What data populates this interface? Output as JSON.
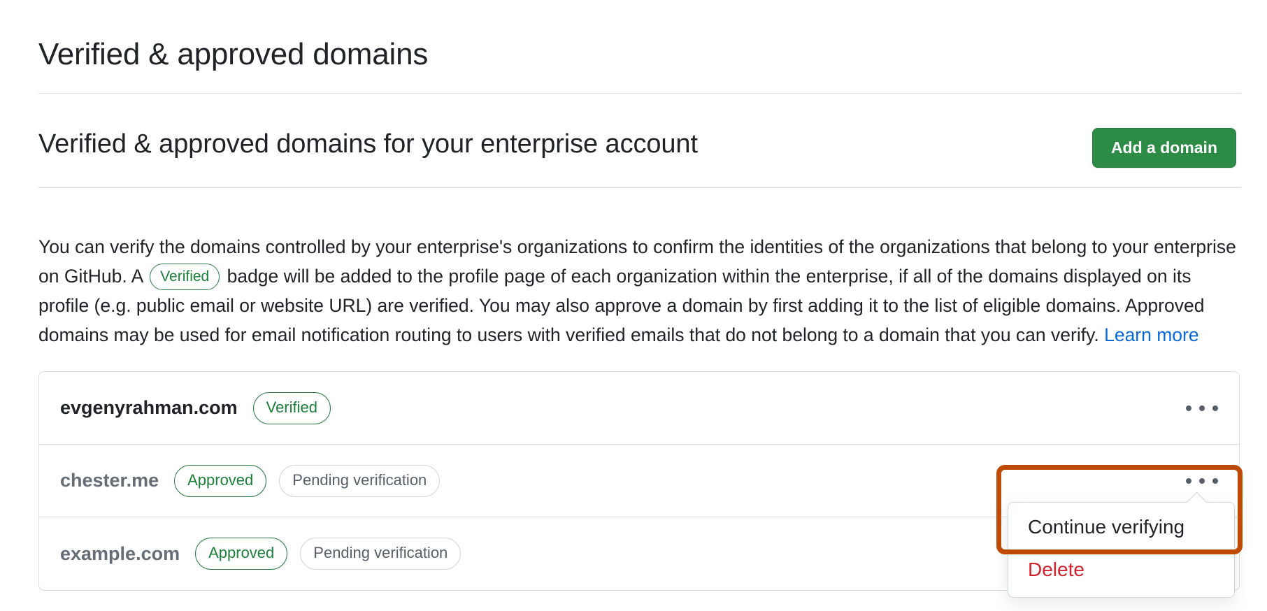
{
  "page": {
    "title": "Verified & approved domains"
  },
  "section": {
    "title": "Verified & approved domains for your enterprise account",
    "add_button_label": "Add a domain"
  },
  "intro": {
    "part1": "You can verify the domains controlled by your enterprise's organizations to confirm the identities of the organizations that belong to your enterprise on GitHub. A",
    "inline_badge": "Verified",
    "part2": "badge will be added to the profile page of each organization within the enterprise, if all of the domains displayed on its profile (e.g. public email or website URL) are verified. You may also approve a domain by first adding it to the list of eligible domains. Approved domains may be used for email notification routing to users with verified emails that do not belong to a domain that you can verify.",
    "learn_more_label": "Learn more"
  },
  "domains": [
    {
      "name": "evgenyrahman.com",
      "muted": false,
      "badges": [
        {
          "label": "Verified",
          "style": "green"
        }
      ],
      "menu_icon": "kebab-horizontal-icon"
    },
    {
      "name": "chester.me",
      "muted": true,
      "badges": [
        {
          "label": "Approved",
          "style": "green"
        },
        {
          "label": "Pending verification",
          "style": "grey"
        }
      ],
      "menu_icon": "kebab-horizontal-icon"
    },
    {
      "name": "example.com",
      "muted": true,
      "badges": [
        {
          "label": "Approved",
          "style": "green"
        },
        {
          "label": "Pending verification",
          "style": "grey"
        }
      ],
      "menu_icon": "kebab-horizontal-icon"
    }
  ],
  "dropdown": {
    "items": [
      {
        "label": "Continue verifying",
        "style": "normal"
      },
      {
        "label": "Delete",
        "style": "danger"
      }
    ]
  },
  "colors": {
    "primary_green": "#2c8c46",
    "badge_green": "#1a7f37",
    "badge_grey_text": "#57606a",
    "link_blue": "#0969da",
    "danger_red": "#cf222e",
    "highlight_orange": "#bf4a04",
    "border_grey": "#d8dee4",
    "text_primary": "#1f2328",
    "text_muted": "#656d76"
  }
}
